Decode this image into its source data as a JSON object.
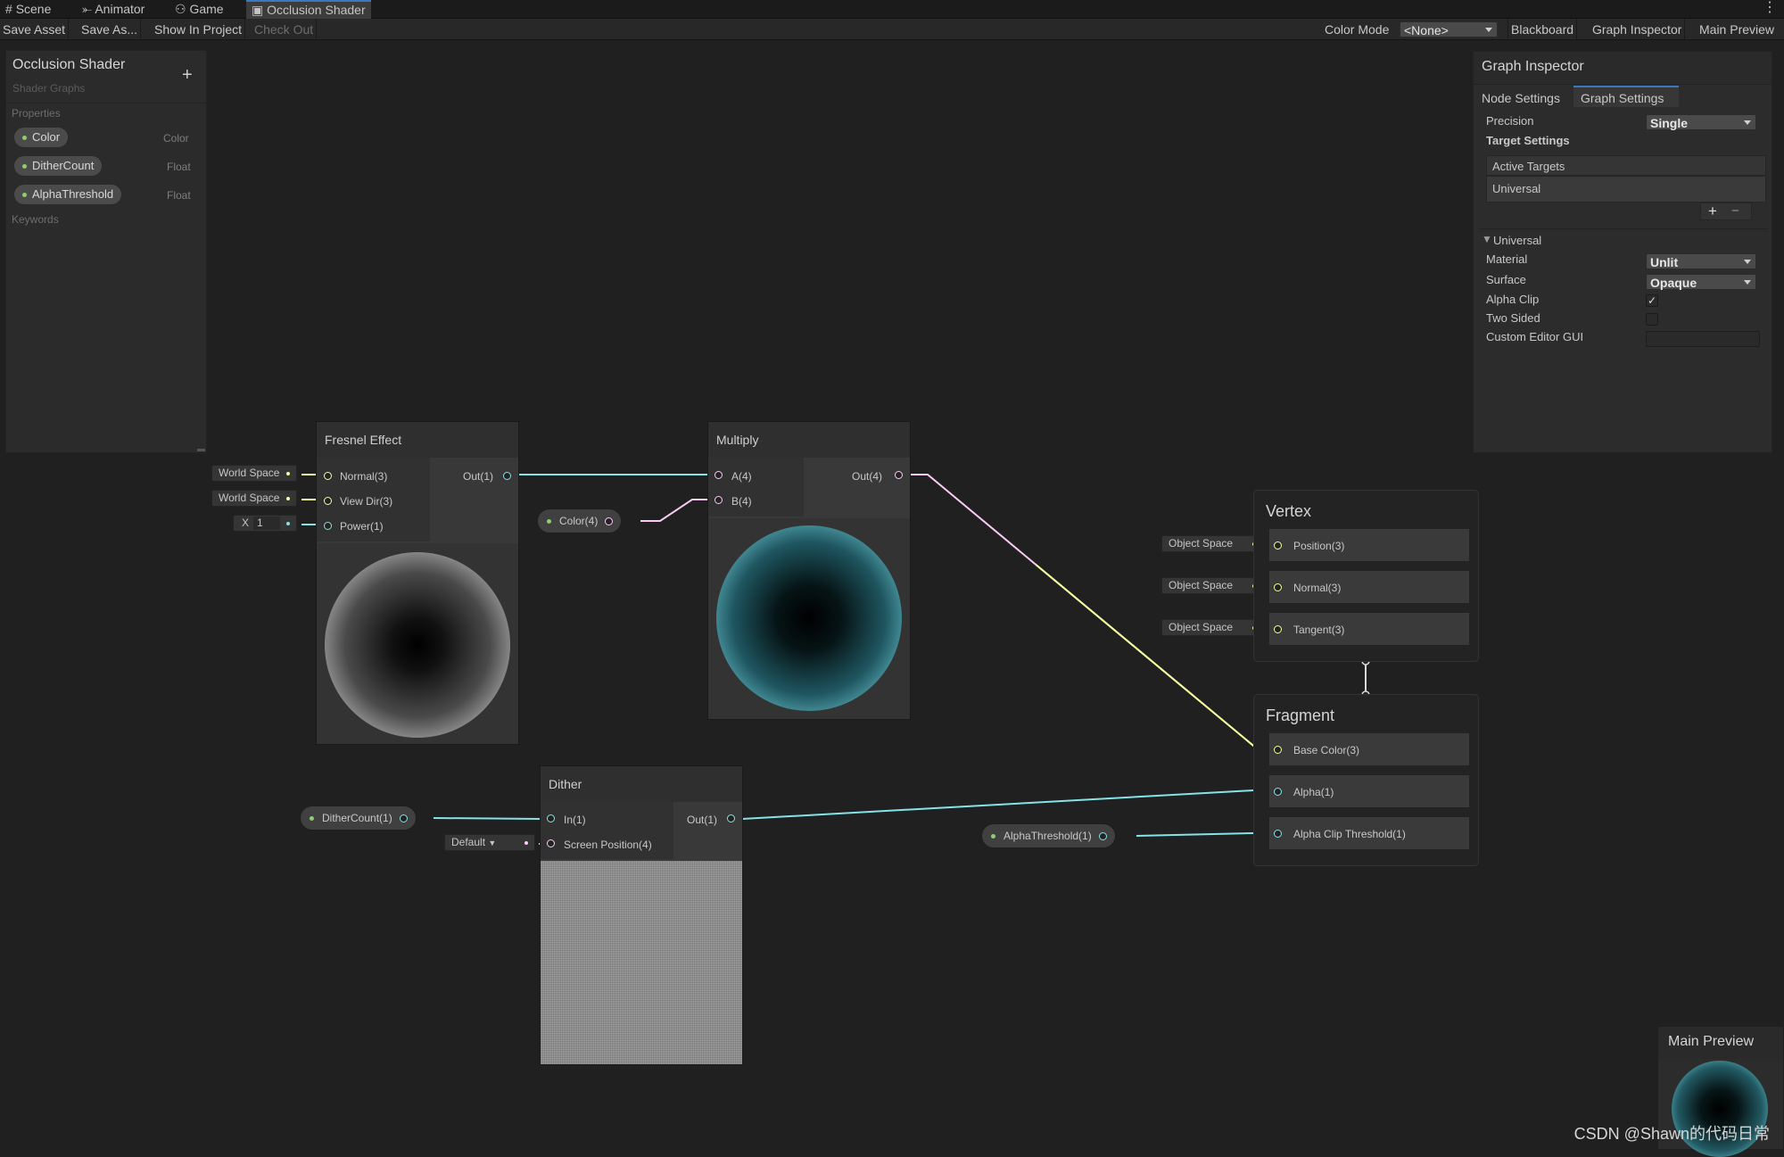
{
  "tabs": [
    {
      "label": "Scene",
      "icon": "scene-grid-icon"
    },
    {
      "label": "Animator",
      "icon": "animator-icon"
    },
    {
      "label": "Game",
      "icon": "gamepad-icon"
    },
    {
      "label": "Occlusion Shader",
      "icon": "shader-graph-icon"
    }
  ],
  "toolbar": {
    "save_asset": "Save Asset",
    "save_as": "Save As...",
    "show_in_project": "Show In Project",
    "check_out": "Check Out",
    "color_mode_label": "Color Mode",
    "color_mode_value": "<None>",
    "blackboard": "Blackboard",
    "graph_inspector": "Graph Inspector",
    "main_preview": "Main Preview"
  },
  "blackboard": {
    "title": "Occlusion Shader",
    "subtitle": "Shader Graphs",
    "add": "+",
    "properties_header": "Properties",
    "properties": [
      {
        "name": "Color",
        "type": "Color"
      },
      {
        "name": "DitherCount",
        "type": "Float"
      },
      {
        "name": "AlphaThreshold",
        "type": "Float"
      }
    ],
    "keywords_header": "Keywords"
  },
  "inspector": {
    "title": "Graph Inspector",
    "tabs": [
      "Node Settings",
      "Graph Settings"
    ],
    "precision_label": "Precision",
    "precision_value": "Single",
    "target_settings": "Target Settings",
    "active_targets": "Active Targets",
    "target": "Universal",
    "add": "+",
    "remove": "−",
    "universal_header": "Universal",
    "material_label": "Material",
    "material_value": "Unlit",
    "surface_label": "Surface",
    "surface_value": "Opaque",
    "alpha_clip_label": "Alpha Clip",
    "alpha_clip_checked": "✓",
    "two_sided_label": "Two Sided",
    "custom_editor_label": "Custom Editor GUI"
  },
  "nodes": {
    "fresnel": {
      "title": "Fresnel Effect",
      "normal": "Normal(3)",
      "view_dir": "View Dir(3)",
      "power": "Power(1)",
      "out": "Out(1)",
      "normal_default": "World Space",
      "view_default": "World Space",
      "power_axis": "X",
      "power_value": "1"
    },
    "multiply": {
      "title": "Multiply",
      "a": "A(4)",
      "b": "B(4)",
      "out": "Out(4)"
    },
    "dither": {
      "title": "Dither",
      "in": "In(1)",
      "screen_pos": "Screen Position(4)",
      "out": "Out(1)",
      "screen_default": "Default"
    },
    "color_prop": "Color(4)",
    "dither_count_prop": "DitherCount(1)",
    "alpha_threshold_prop": "AlphaThreshold(1)"
  },
  "vertex": {
    "title": "Vertex",
    "slots": [
      {
        "label": "Position(3)",
        "default": "Object Space"
      },
      {
        "label": "Normal(3)",
        "default": "Object Space"
      },
      {
        "label": "Tangent(3)",
        "default": "Object Space"
      }
    ]
  },
  "fragment": {
    "title": "Fragment",
    "slots": [
      {
        "label": "Base Color(3)"
      },
      {
        "label": "Alpha(1)"
      },
      {
        "label": "Alpha Clip Threshold(1)"
      }
    ]
  },
  "main_preview_title": "Main Preview",
  "watermark": "CSDN @Shawn的代码日常",
  "colors": {
    "vector3_port": "#f6ff9a",
    "vector1_port": "#84e4e7",
    "vector4_port": "#fbcbf4",
    "preview_teal": "#7fd6df",
    "accent": "#3a79bb"
  }
}
